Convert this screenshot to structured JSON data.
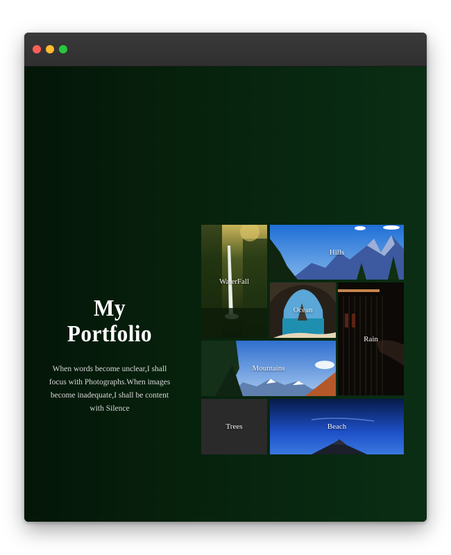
{
  "window": {
    "controls": [
      {
        "name": "close-button",
        "color": "#ff5f57"
      },
      {
        "name": "minimize-button",
        "color": "#febc2e"
      },
      {
        "name": "maximize-button",
        "color": "#28c840"
      }
    ]
  },
  "hero": {
    "title": "My Portfolio",
    "subtitle": "When words become unclear,I shall focus with Photographs.When images become inadequate,I shall be content with Silence"
  },
  "gallery": {
    "tiles": [
      {
        "label": "WaterFall",
        "icon": "waterfall-photo"
      },
      {
        "label": "Hills",
        "icon": "hills-photo"
      },
      {
        "label": "Ocean",
        "icon": "ocean-photo"
      },
      {
        "label": "Rain",
        "icon": "rain-photo"
      },
      {
        "label": "Mountains",
        "icon": "mountains-photo"
      },
      {
        "label": "Trees",
        "icon": "trees-placeholder"
      },
      {
        "label": "Beach",
        "icon": "beach-photo"
      }
    ]
  },
  "colors": {
    "background_dark": "#041608",
    "background_light": "#0a2e14",
    "titlebar": "#333333",
    "text": "#ffffff"
  }
}
